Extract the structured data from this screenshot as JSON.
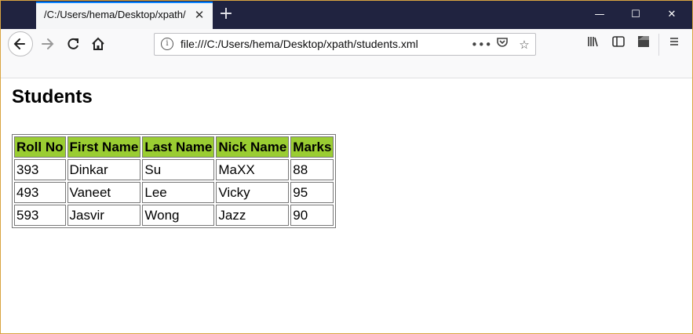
{
  "browser": {
    "tab_title": "/C:/Users/hema/Desktop/xpath/",
    "tab_close": "✕",
    "new_tab": "+",
    "url": "file:///C:/Users/hema/Desktop/xpath/students.xml",
    "page_actions": "•••",
    "window_controls": {
      "minimize": "—",
      "maximize": "☐",
      "close": "✕"
    },
    "icons": [
      "back-icon",
      "forward-icon",
      "reload-icon",
      "home-icon",
      "info-icon",
      "pocket-icon",
      "bookmark-star-icon",
      "library-icon",
      "sidebar-icon",
      "selenium-icon",
      "menu-icon"
    ]
  },
  "page": {
    "heading": "Students",
    "table": {
      "headers": [
        "Roll No",
        "First Name",
        "Last Name",
        "Nick Name",
        "Marks"
      ],
      "rows": [
        [
          "393",
          "Dinkar",
          "Su",
          "MaXX",
          "88"
        ],
        [
          "493",
          "Vaneet",
          "Lee",
          "Vicky",
          "95"
        ],
        [
          "593",
          "Jasvir",
          "Wong",
          "Jazz",
          "90"
        ]
      ]
    }
  },
  "colors": {
    "titlebar": "#202340",
    "accent": "#0a84ff",
    "header_bg": "#9acd32"
  }
}
